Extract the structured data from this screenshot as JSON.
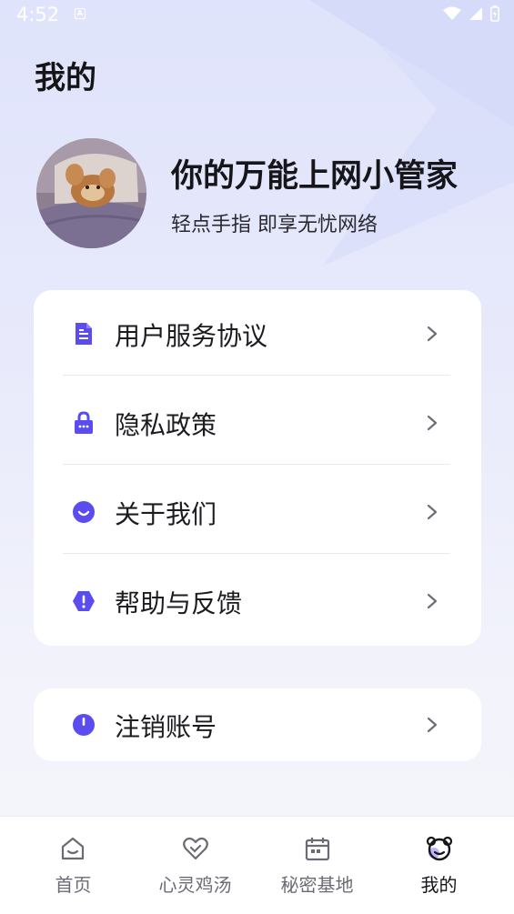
{
  "status_bar": {
    "time": "4:52",
    "notification_letter": "A"
  },
  "page": {
    "title": "我的"
  },
  "profile": {
    "headline": "你的万能上网小管家",
    "subline": "轻点手指 即享无忧网络"
  },
  "menu": {
    "items": [
      {
        "label": "用户服务协议",
        "icon": "document-icon"
      },
      {
        "label": "隐私政策",
        "icon": "lock-icon"
      },
      {
        "label": "关于我们",
        "icon": "smile-icon"
      },
      {
        "label": "帮助与反馈",
        "icon": "alert-icon"
      }
    ]
  },
  "logout": {
    "label": "注销账号",
    "icon": "power-icon"
  },
  "tab_bar": {
    "tabs": [
      {
        "label": "首页",
        "icon": "home-icon",
        "active": false
      },
      {
        "label": "心灵鸡汤",
        "icon": "heart-icon",
        "active": false
      },
      {
        "label": "秘密基地",
        "icon": "calendar-icon",
        "active": false
      },
      {
        "label": "我的",
        "icon": "bear-icon",
        "active": true
      }
    ]
  },
  "colors": {
    "accent": "#5b4cf0",
    "card": "#ffffff",
    "text": "#1c1c20",
    "muted": "#6b6b76"
  }
}
